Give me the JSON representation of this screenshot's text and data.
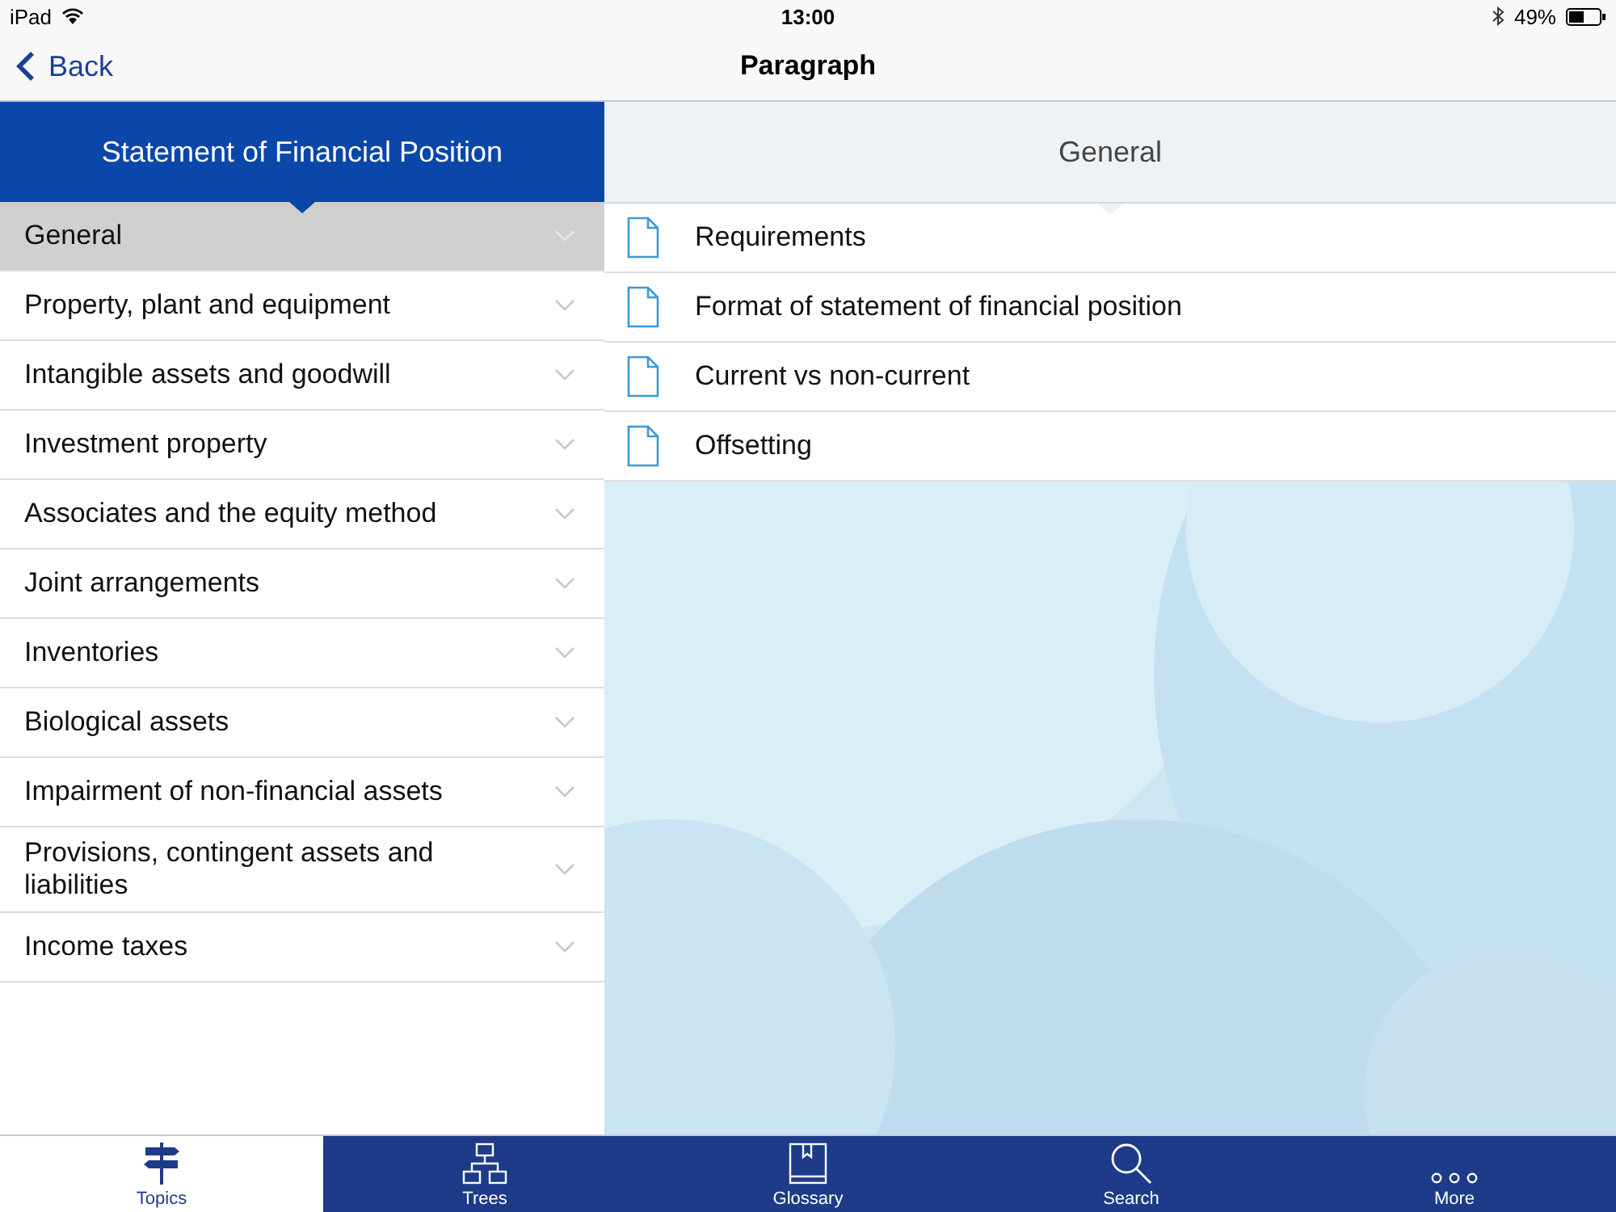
{
  "status_bar": {
    "device": "iPad",
    "time": "13:00",
    "battery": "49%"
  },
  "nav_bar": {
    "back": "Back",
    "title": "Paragraph"
  },
  "left_header": "Statement of Financial Position",
  "right_header": "General",
  "topics": [
    {
      "label": "General",
      "selected": true
    },
    {
      "label": "Property, plant and equipment",
      "selected": false
    },
    {
      "label": "Intangible assets and goodwill",
      "selected": false
    },
    {
      "label": "Investment property",
      "selected": false
    },
    {
      "label": "Associates and the equity method",
      "selected": false
    },
    {
      "label": "Joint arrangements",
      "selected": false
    },
    {
      "label": "Inventories",
      "selected": false
    },
    {
      "label": "Biological assets",
      "selected": false
    },
    {
      "label": "Impairment of non-financial assets",
      "selected": false
    },
    {
      "label": "Provisions, contingent assets and liabilities",
      "selected": false
    },
    {
      "label": "Income taxes",
      "selected": false
    }
  ],
  "documents": [
    "Requirements",
    "Format of statement of financial position",
    "Current vs non-current",
    "Offsetting"
  ],
  "tab_bar": [
    {
      "kind": "topics",
      "label": "Topics",
      "selected": true
    },
    {
      "kind": "trees",
      "label": "Trees",
      "selected": false
    },
    {
      "kind": "glossary",
      "label": "Glossary",
      "selected": false
    },
    {
      "kind": "search",
      "label": "Search",
      "selected": false
    },
    {
      "kind": "more",
      "label": "More",
      "selected": false
    }
  ]
}
